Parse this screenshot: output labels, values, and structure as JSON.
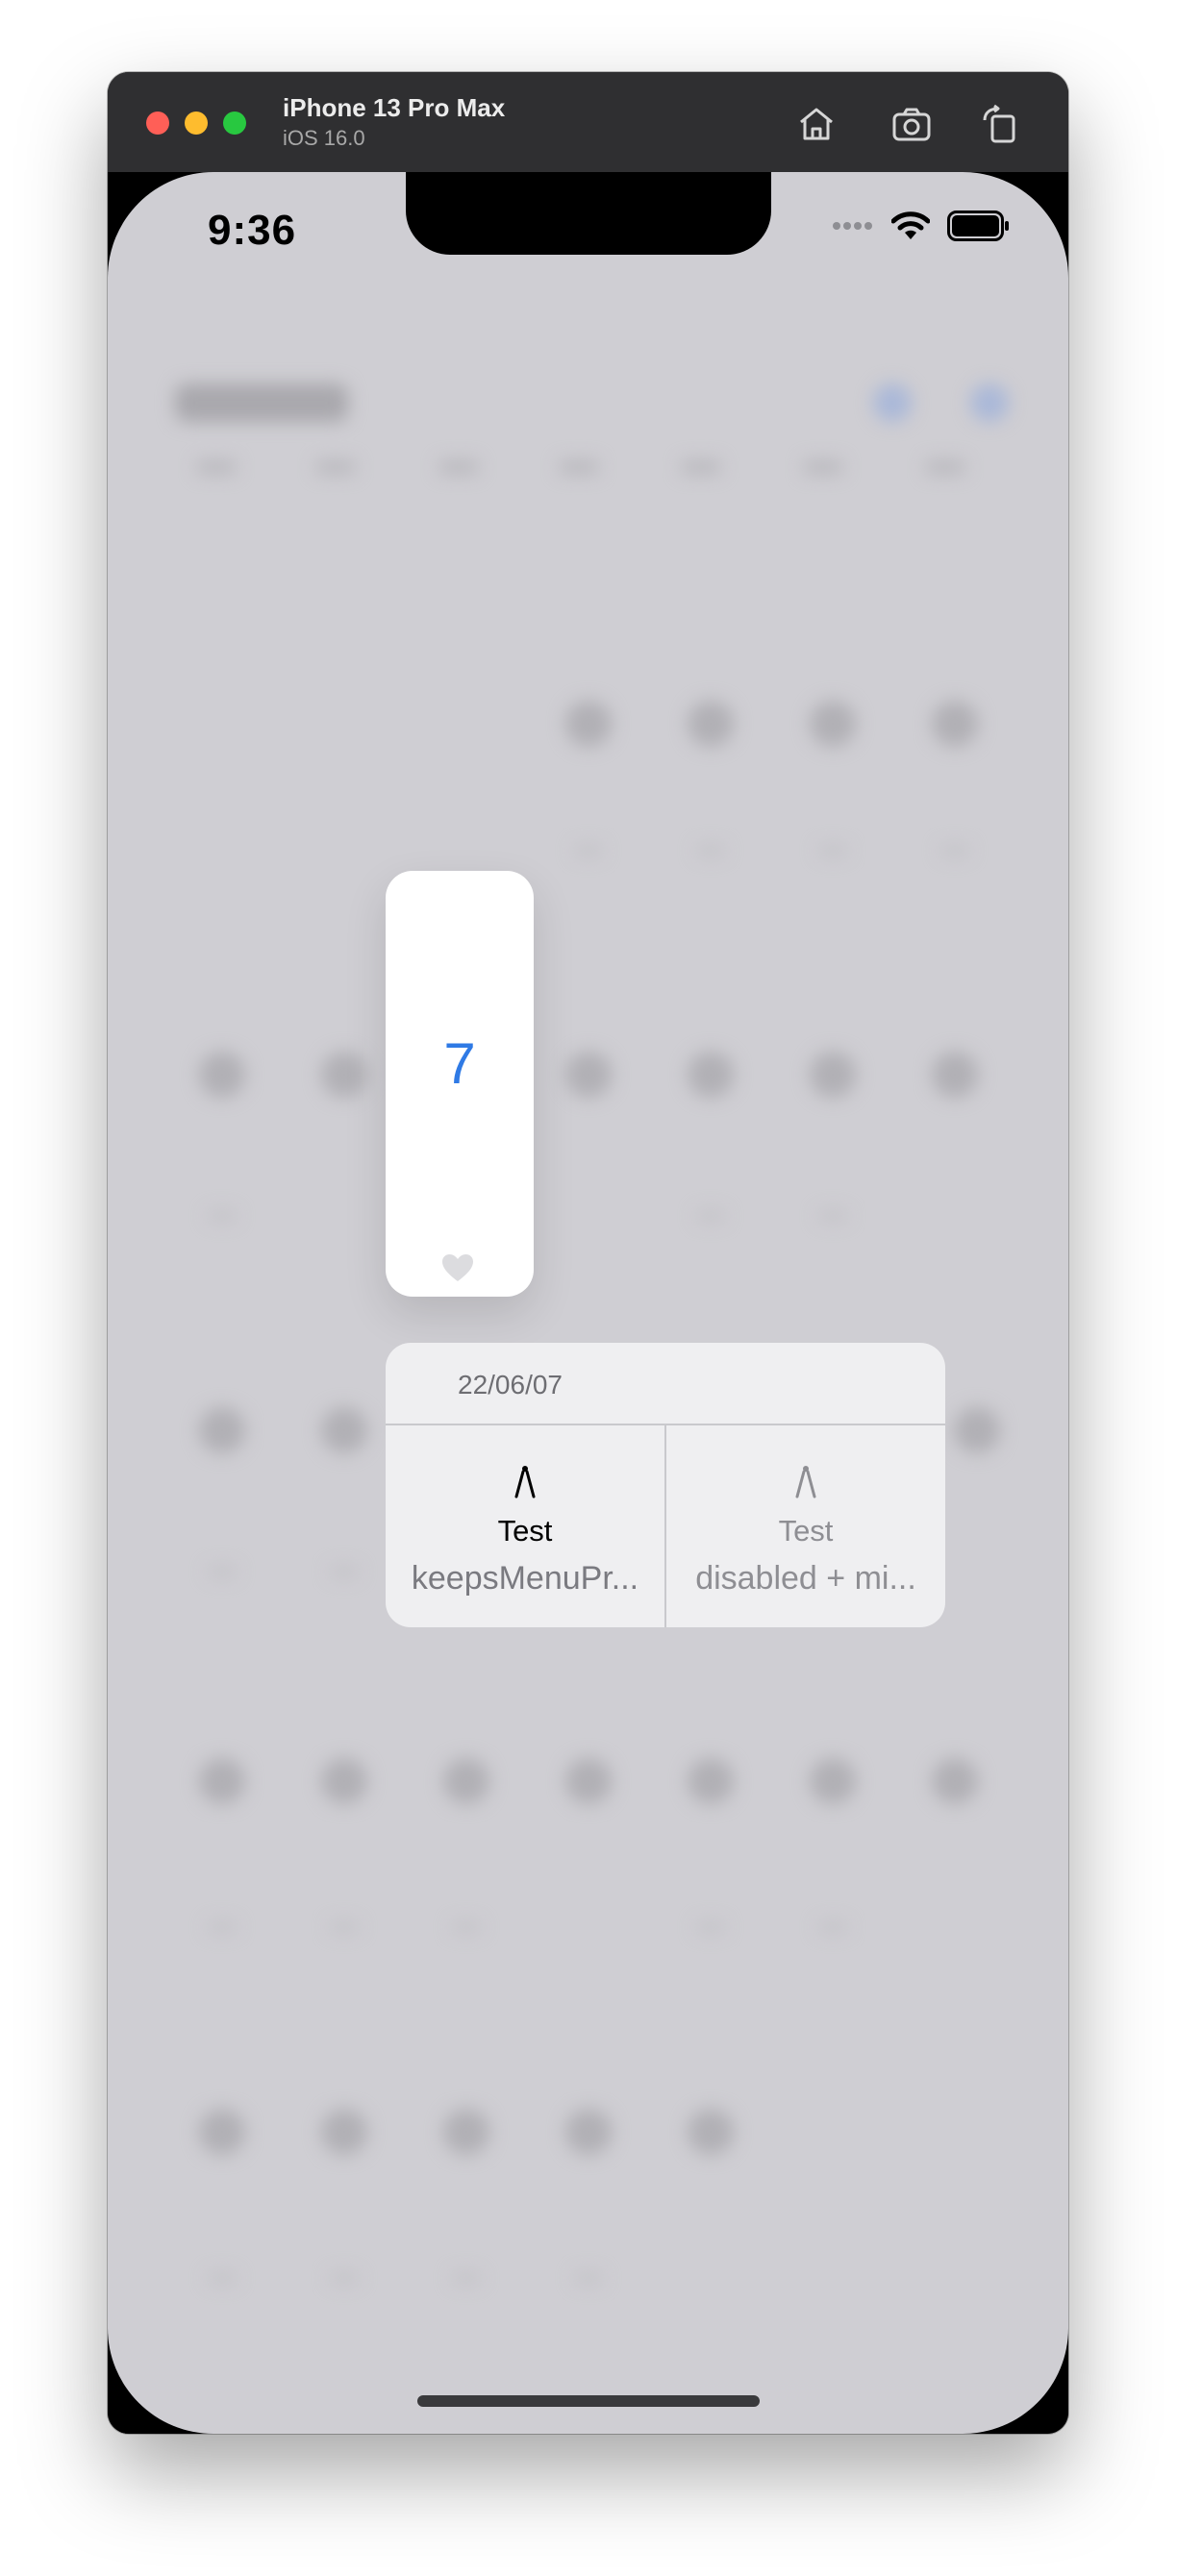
{
  "simulator": {
    "device_name": "iPhone 13 Pro Max",
    "os_version": "iOS 16.0",
    "buttons": [
      "home-icon",
      "screenshot-icon",
      "rotate-icon"
    ]
  },
  "status_bar": {
    "time": "9:36"
  },
  "selected_day": {
    "number": "7"
  },
  "context_menu": {
    "header": "22/06/07",
    "items": [
      {
        "title": "Test",
        "subtitle": "keepsMenuPr...",
        "icon": "compass-icon",
        "enabled": true
      },
      {
        "title": "Test",
        "subtitle": "disabled + mi...",
        "icon": "compass-icon",
        "enabled": false
      }
    ]
  },
  "colors": {
    "accent": "#2f7ae5",
    "background_dim": "#cfced3",
    "menu_bg": "#efeff1"
  }
}
